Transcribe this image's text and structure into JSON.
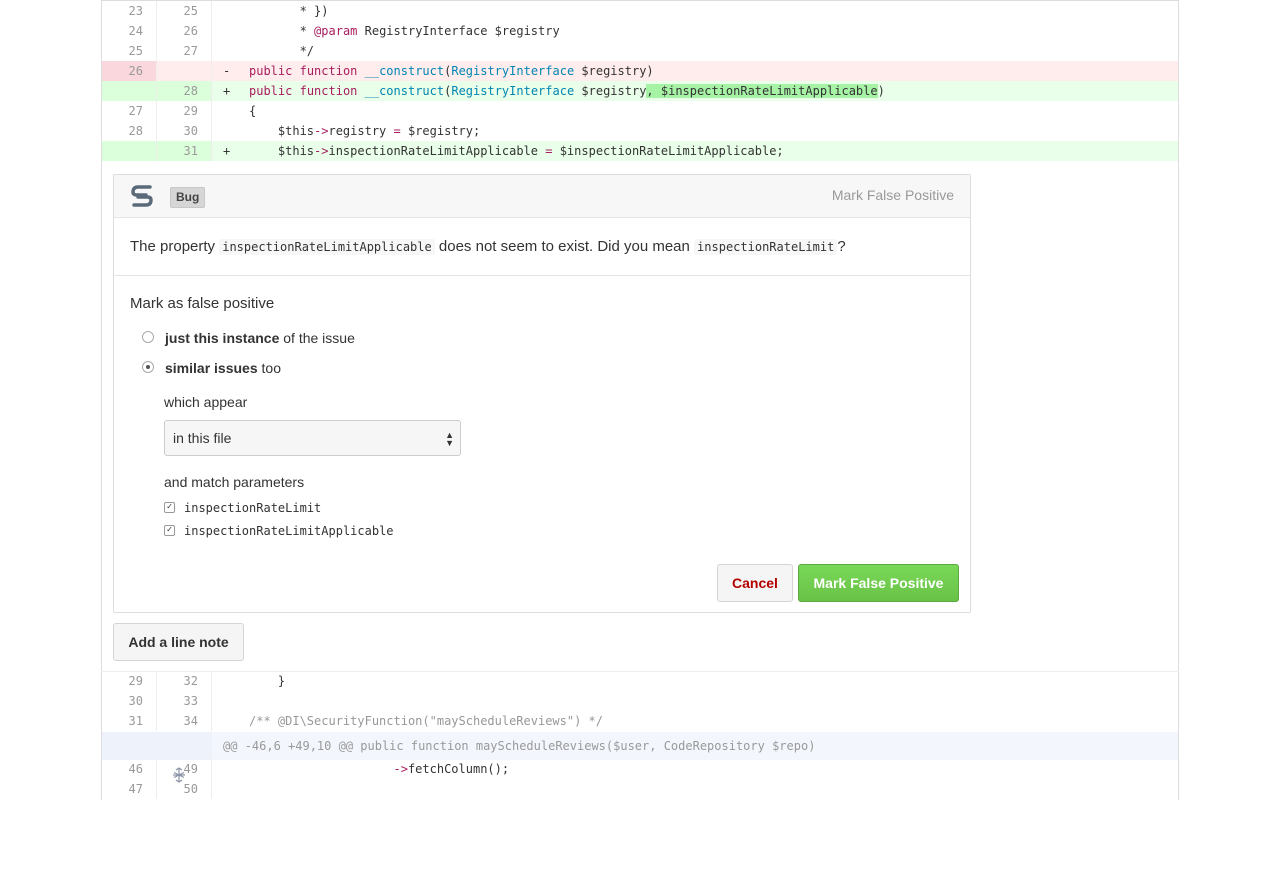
{
  "diff_top": [
    {
      "old": "23",
      "new": "25",
      "type": "ctx",
      "mark": "",
      "code": " * })"
    },
    {
      "old": "24",
      "new": "26",
      "type": "ctx",
      "mark": "",
      "code_parts": [
        " * ",
        "@param",
        " RegistryInterface $registry"
      ]
    },
    {
      "old": "25",
      "new": "27",
      "type": "ctx",
      "mark": "",
      "code": " */"
    },
    {
      "old": "26",
      "new": "",
      "type": "del",
      "mark": "-",
      "code_parts": [
        "public",
        " ",
        "function",
        " ",
        "__construct",
        "(",
        "RegistryInterface",
        " $registry)"
      ]
    },
    {
      "old": "",
      "new": "28",
      "type": "add",
      "mark": "+",
      "code_parts": [
        "public",
        " ",
        "function",
        " ",
        "__construct",
        "(",
        "RegistryInterface",
        " $registry",
        ", $inspectionRateLimitApplicable",
        ")"
      ]
    },
    {
      "old": "27",
      "new": "29",
      "type": "ctx",
      "mark": "",
      "code": "{"
    },
    {
      "old": "28",
      "new": "30",
      "type": "ctx",
      "mark": "",
      "code_parts": [
        "    $this",
        "->",
        "registry ",
        "=",
        " $registry;"
      ]
    },
    {
      "old": "",
      "new": "31",
      "type": "add",
      "mark": "+",
      "code_parts": [
        "    $this",
        "->",
        "inspectionRateLimitApplicable ",
        "=",
        " $inspectionRateLimitApplicable;"
      ]
    }
  ],
  "issue": {
    "badge": "Bug",
    "mark_fp_link": "Mark False Positive",
    "message_pre": "The property",
    "message_code1": "inspectionRateLimitApplicable",
    "message_mid": "does not seem to exist. Did you mean",
    "message_code2": "inspectionRateLimit",
    "message_post": "?",
    "section_title": "Mark as false positive",
    "option1_bold": "just this instance",
    "option1_rest": " of the issue",
    "option2_bold": "similar issues",
    "option2_rest": " too",
    "which_appear": "which appear",
    "select_value": "in this file",
    "match_params": "and match parameters",
    "param1": "inspectionRateLimit",
    "param2": "inspectionRateLimitApplicable",
    "cancel": "Cancel",
    "confirm": "Mark False Positive"
  },
  "add_note": "Add a line note",
  "diff_bottom": [
    {
      "old": "29",
      "new": "32",
      "code": "}"
    },
    {
      "old": "30",
      "new": "33",
      "code": ""
    },
    {
      "old": "31",
      "new": "34",
      "code": "/** @DI\\SecurityFunction(\"mayScheduleReviews\") */"
    }
  ],
  "hunk": "@@ -46,6 +49,10 @@ public function mayScheduleReviews($user, CodeRepository $repo)",
  "diff_tail": [
    {
      "old": "46",
      "new": "49",
      "code_parts": [
        "                    ",
        "->",
        "fetchColumn();"
      ]
    },
    {
      "old": "47",
      "new": "50",
      "code": ""
    }
  ],
  "colors": {
    "accent_green": "#6cc644",
    "cancel_red": "#b30000",
    "del_bg": "#ffecec",
    "add_bg": "#eaffea"
  }
}
